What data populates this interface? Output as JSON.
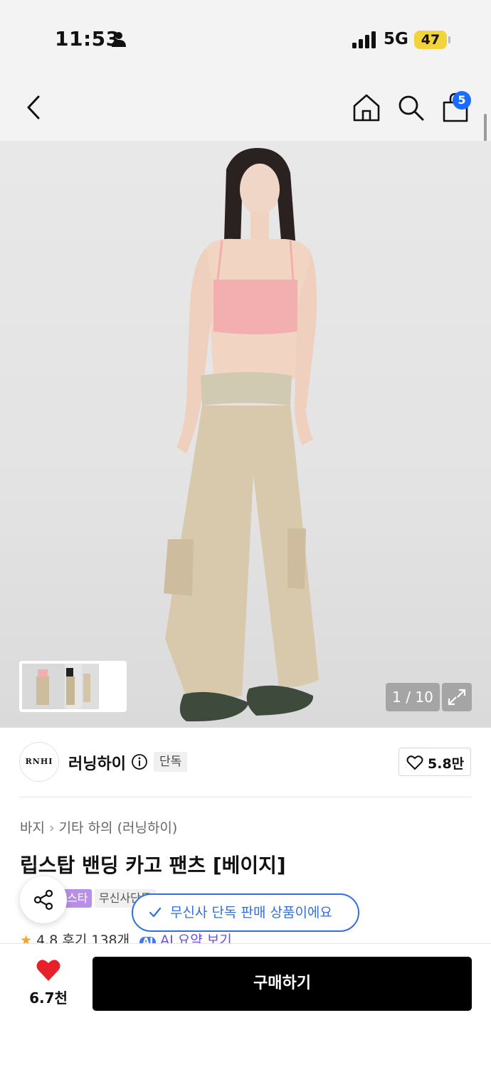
{
  "status_bar": {
    "time": "11:53",
    "network": "5G",
    "battery": "47",
    "icons": [
      "person-icon",
      "signal-icon"
    ]
  },
  "header": {
    "icons": [
      "back-arrow-icon",
      "home-icon",
      "search-icon",
      "shopping-bag-icon"
    ],
    "cart_badge": "5"
  },
  "gallery": {
    "counter": "1 / 10",
    "expand_icon": "expand-icon"
  },
  "brand": {
    "logo_text": "RNHI",
    "name": "러닝하이",
    "info_icon": "info-icon",
    "exclusive_tag": "단독",
    "likes": "5.8만"
  },
  "product": {
    "breadcrumb": [
      "바지",
      "기타 하의 (러닝하이)"
    ],
    "title": "립스탑 밴딩 카고 팬츠 [베이지]",
    "tags": [
      "스타",
      "무신사단독"
    ],
    "rating": "4.8",
    "reviews": "후기 138개",
    "ai_badge": "AI",
    "ai_summary": "AI 요약 보기"
  },
  "toast": {
    "text": "무신사 단독 판매 상품이에요"
  },
  "bottom_bar": {
    "wish_count": "6.7천",
    "buy_label": "구매하기"
  },
  "colors": {
    "accent_blue": "#2f6fe6",
    "badge_blue": "#1a6cff",
    "heart_red": "#e8202a",
    "battery_yellow": "#f2d33b",
    "tag_purple": "#b98ee8",
    "buy_button": "#000000"
  }
}
